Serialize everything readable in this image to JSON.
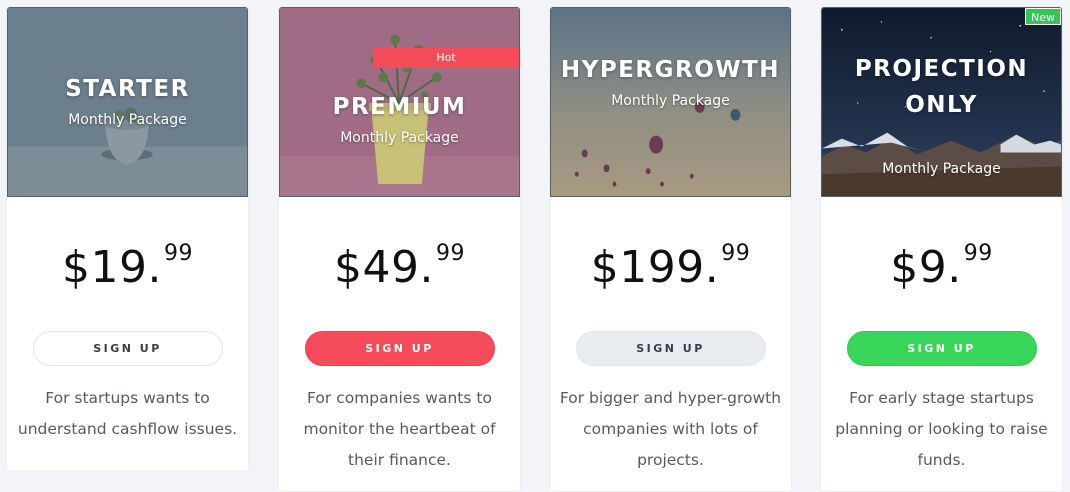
{
  "plans": [
    {
      "name": "STARTER",
      "subtitle": "Monthly Package",
      "price_main": "$19.",
      "price_cents": "99",
      "cta": "SIGN UP",
      "description": "For startups wants to understand cashflow issues."
    },
    {
      "name": "PREMIUM",
      "subtitle": "Monthly Package",
      "badge": "Hot",
      "price_main": "$49.",
      "price_cents": "99",
      "cta": "SIGN UP",
      "description": "For companies wants to monitor the heartbeat of their finance."
    },
    {
      "name": "HYPERGROWTH",
      "subtitle": "Monthly Package",
      "price_main": "$199.",
      "price_cents": "99",
      "cta": "SIGN UP",
      "description": "For bigger and hyper-growth companies with lots of projects."
    },
    {
      "name_line1": "PROJECTION",
      "name_line2": "ONLY",
      "subtitle": "Monthly Package",
      "badge": "New",
      "price_main": "$9.",
      "price_cents": "99",
      "cta": "SIGN UP",
      "description": "For early stage startups planning or looking to raise funds."
    }
  ],
  "colors": {
    "red": "#f64b5a",
    "green": "#37d55a",
    "gray_button": "#e8ebf0",
    "text": "#555a62"
  }
}
